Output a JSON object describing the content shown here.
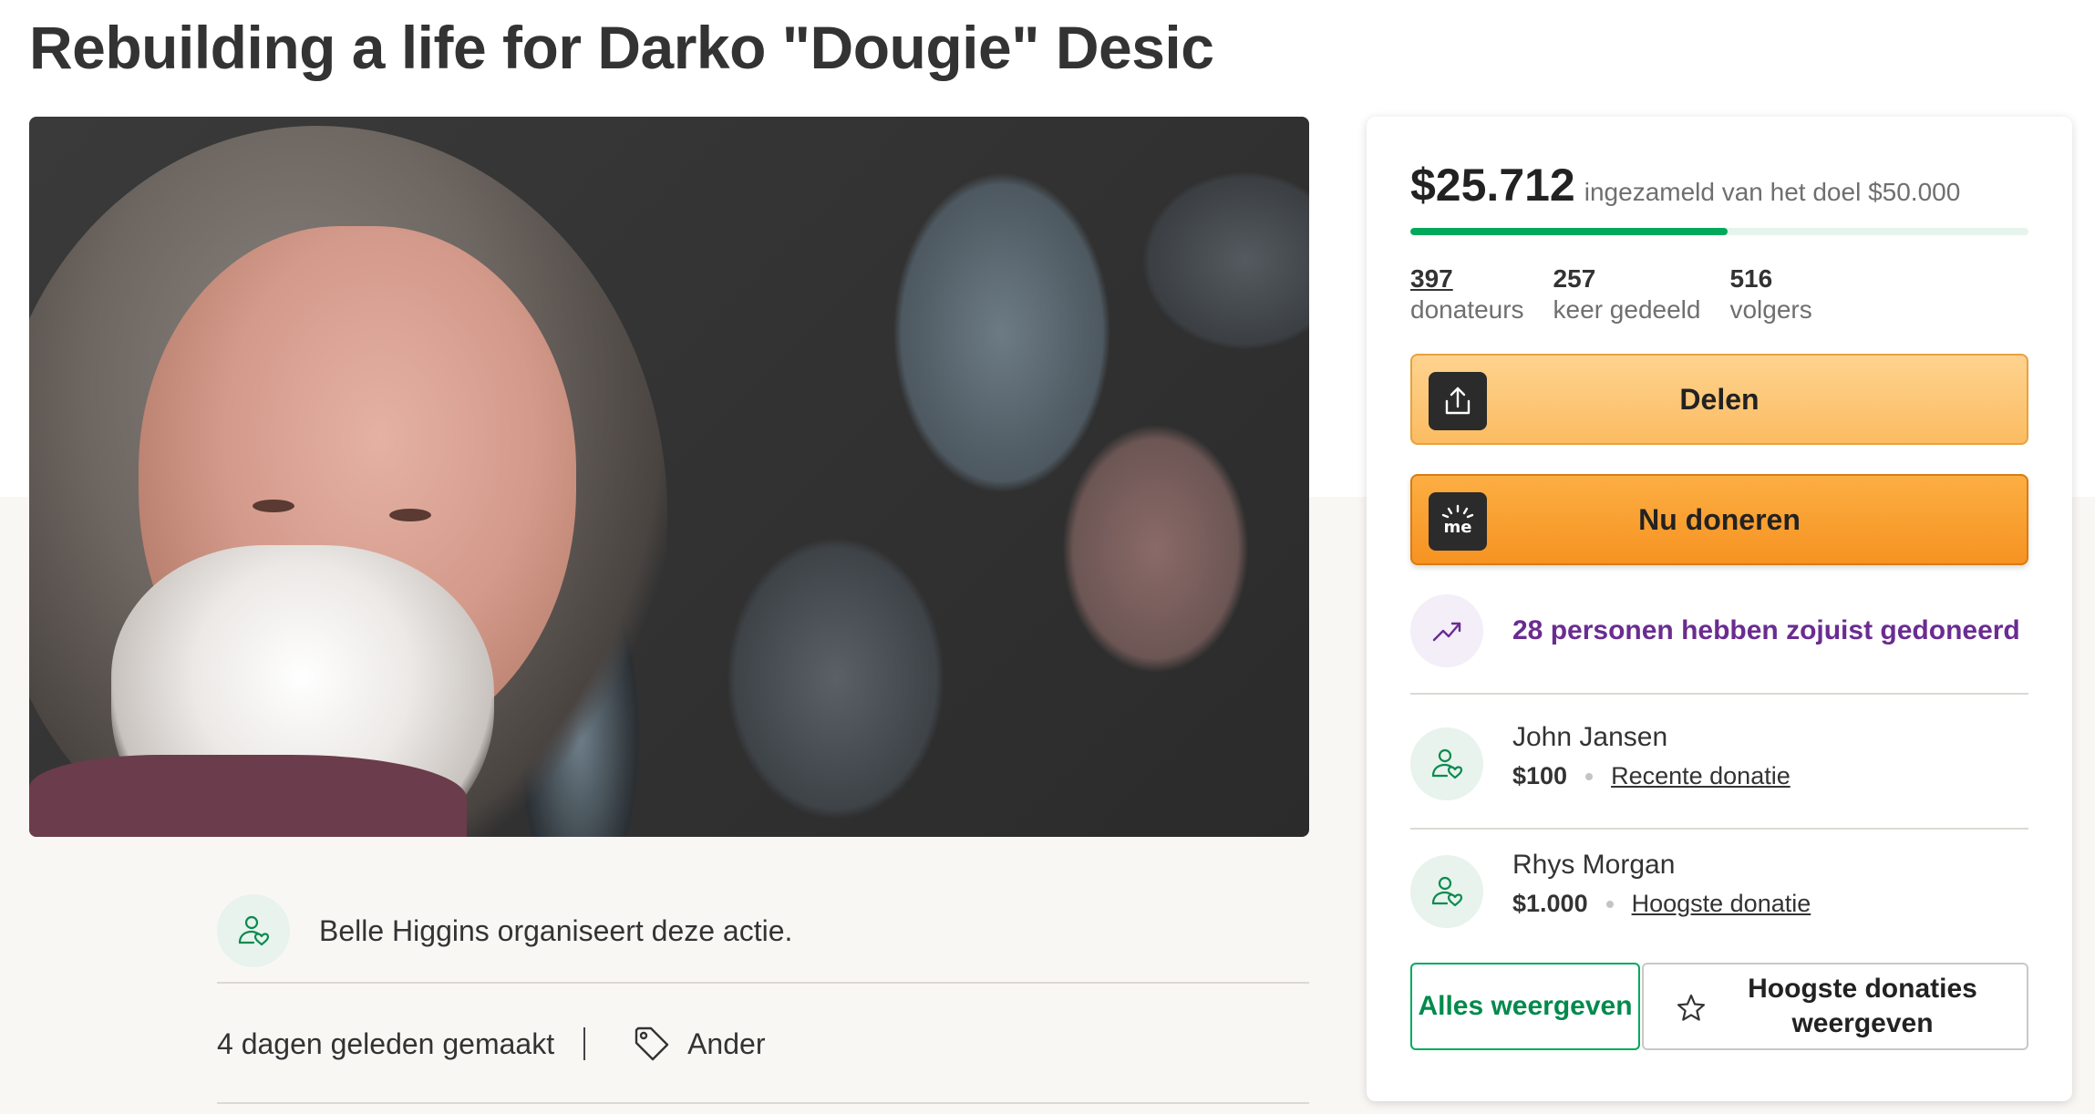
{
  "page": {
    "title": "Rebuilding a life for Darko \"Dougie\" Desic"
  },
  "organizer": {
    "text": "Belle Higgins organiseert deze actie.",
    "icon": "user-heart-icon"
  },
  "meta": {
    "created": "4 dagen geleden gemaakt",
    "category": "Ander",
    "category_icon": "tag-icon"
  },
  "donation_card": {
    "raised": "$25.712",
    "goal_text": "ingezameld van het doel $50.000",
    "progress_fraction": 0.514,
    "stats": {
      "donors_count": "397",
      "donors_label": "donateurs",
      "shares_count": "257",
      "shares_label": "keer gedeeld",
      "followers_count": "516",
      "followers_label": "volgers"
    },
    "share_label": "Delen",
    "donate_label": "Nu doneren",
    "donate_icon_text": "me",
    "recent_text": "28 personen hebben zojuist gedoneerd",
    "donors": [
      {
        "name": "John Jansen",
        "amount": "$100",
        "tag": "Recente donatie"
      },
      {
        "name": "Rhys Morgan",
        "amount": "$1.000",
        "tag": "Hoogste donatie"
      }
    ],
    "show_all_label": "Alles weergeven",
    "show_top_label": "Hoogste donaties weergeven"
  },
  "colors": {
    "accent_green": "#02a95c",
    "donate_orange": "#f69322",
    "share_yellow": "#fbbc62",
    "recent_purple": "#6a2c91"
  }
}
